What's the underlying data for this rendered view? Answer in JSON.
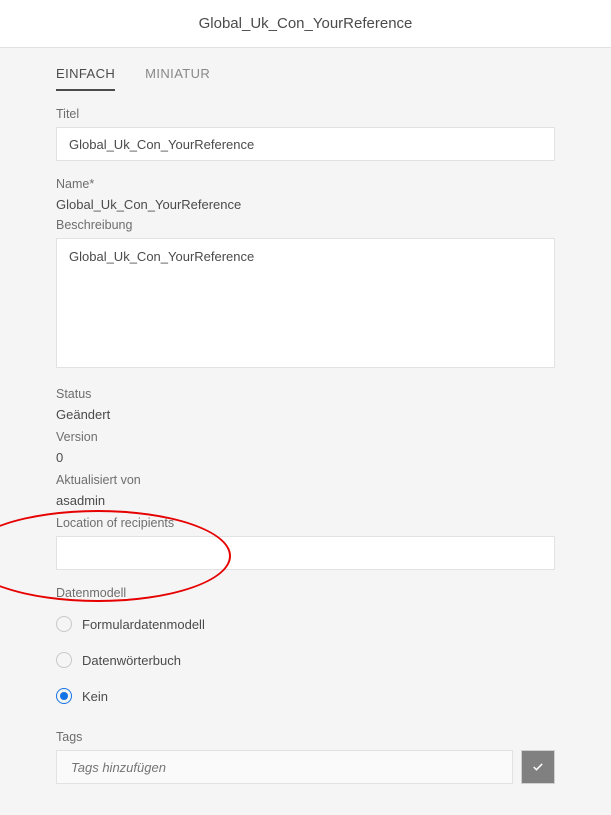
{
  "header": {
    "title": "Global_Uk_Con_YourReference"
  },
  "tabs": [
    {
      "label": "EINFACH",
      "active": true
    },
    {
      "label": "MINIATUR",
      "active": false
    }
  ],
  "fields": {
    "titel": {
      "label": "Titel",
      "value": "Global_Uk_Con_YourReference"
    },
    "name": {
      "label": "Name*",
      "value": "Global_Uk_Con_YourReference"
    },
    "beschreibung": {
      "label": "Beschreibung",
      "value": "Global_Uk_Con_YourReference"
    },
    "status": {
      "label": "Status",
      "value": "Geändert"
    },
    "version": {
      "label": "Version",
      "value": "0"
    },
    "aktualisiert_von": {
      "label": "Aktualisiert von",
      "value": "asadmin"
    },
    "location_of_recipients": {
      "label": "Location of recipients",
      "value": ""
    },
    "datenmodell": {
      "label": "Datenmodell",
      "options": [
        {
          "label": "Formulardatenmodell",
          "checked": false
        },
        {
          "label": "Datenwörterbuch",
          "checked": false
        },
        {
          "label": "Kein",
          "checked": true
        }
      ]
    },
    "tags": {
      "label": "Tags",
      "placeholder": "Tags hinzufügen"
    }
  }
}
